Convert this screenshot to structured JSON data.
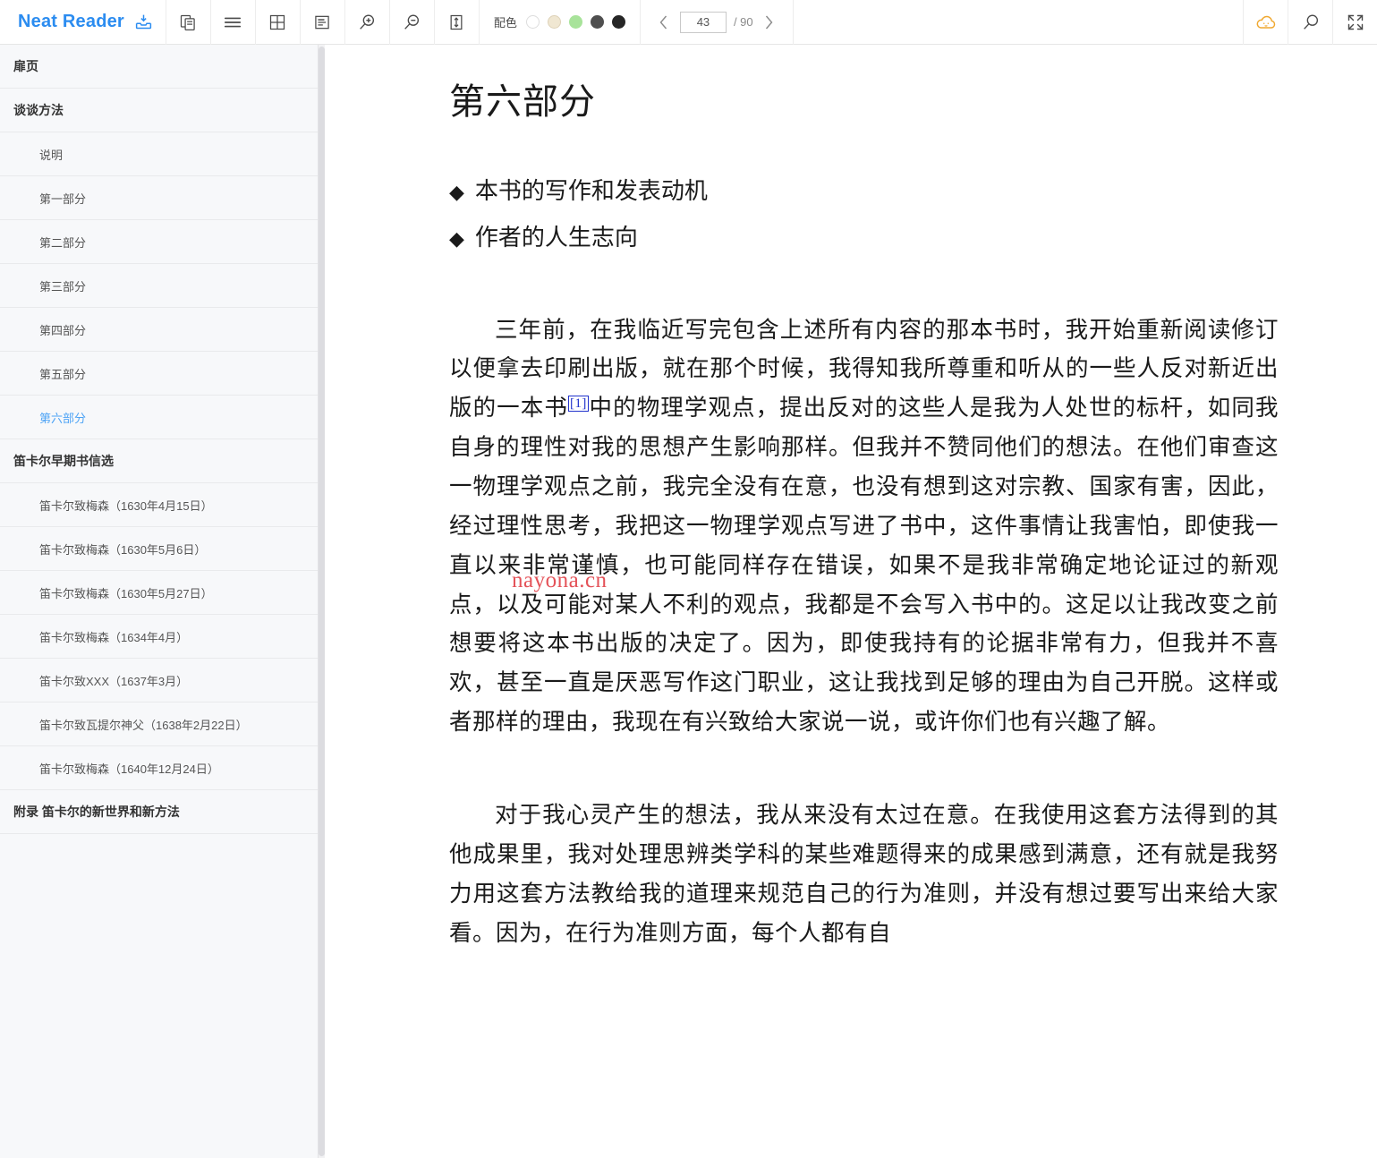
{
  "app": {
    "brand": "Neat Reader",
    "download_icon": "download-tray-icon"
  },
  "toolbar": {
    "buttons": [
      {
        "name": "copy-pages-icon",
        "title": "复制"
      },
      {
        "name": "list-lines-icon",
        "title": "目录"
      },
      {
        "name": "grid-layout-icon",
        "title": "双页"
      },
      {
        "name": "text-layout-icon",
        "title": "排版"
      },
      {
        "name": "zoom-in-icon",
        "title": "放大"
      },
      {
        "name": "zoom-out-icon",
        "title": "缩小"
      },
      {
        "name": "line-height-icon",
        "title": "行距"
      }
    ],
    "scheme_label": "配色",
    "swatches": [
      {
        "name": "scheme-white",
        "color": "#ffffff",
        "border": "#dddddd"
      },
      {
        "name": "scheme-cream",
        "color": "#f0e7d2",
        "border": "#ded2b8"
      },
      {
        "name": "scheme-green",
        "color": "#a8e39a",
        "border": "#a8e39a"
      },
      {
        "name": "scheme-gray",
        "color": "#4f4f4f",
        "border": "#4f4f4f"
      },
      {
        "name": "scheme-black",
        "color": "#262626",
        "border": "#262626"
      }
    ],
    "pager": {
      "prev": "‹",
      "current": "43",
      "separator": "/ 90",
      "total": "90",
      "next": "›"
    },
    "right_buttons": [
      {
        "name": "cloud-sync-icon",
        "title": "云同步",
        "color": "#f0a830"
      },
      {
        "name": "search-icon",
        "title": "搜索"
      },
      {
        "name": "fullscreen-icon",
        "title": "全屏"
      }
    ]
  },
  "sidebar": {
    "items": [
      {
        "label": "扉页",
        "level": 0,
        "active": false
      },
      {
        "label": "谈谈方法",
        "level": 0,
        "active": false
      },
      {
        "label": "说明",
        "level": 1,
        "active": false
      },
      {
        "label": "第一部分",
        "level": 1,
        "active": false
      },
      {
        "label": "第二部分",
        "level": 1,
        "active": false
      },
      {
        "label": "第三部分",
        "level": 1,
        "active": false
      },
      {
        "label": "第四部分",
        "level": 1,
        "active": false
      },
      {
        "label": "第五部分",
        "level": 1,
        "active": false
      },
      {
        "label": "第六部分",
        "level": 1,
        "active": true
      },
      {
        "label": "笛卡尔早期书信选",
        "level": 0,
        "active": false
      },
      {
        "label": "笛卡尔致梅森（1630年4月15日）",
        "level": 1,
        "active": false
      },
      {
        "label": "笛卡尔致梅森（1630年5月6日）",
        "level": 1,
        "active": false
      },
      {
        "label": "笛卡尔致梅森（1630年5月27日）",
        "level": 1,
        "active": false
      },
      {
        "label": "笛卡尔致梅森（1634年4月）",
        "level": 1,
        "active": false
      },
      {
        "label": "笛卡尔致XXX（1637年3月）",
        "level": 1,
        "active": false
      },
      {
        "label": "笛卡尔致瓦提尔神父（1638年2月22日）",
        "level": 1,
        "active": false
      },
      {
        "label": "笛卡尔致梅森（1640年12月24日）",
        "level": 1,
        "active": false
      },
      {
        "label": "附录 笛卡尔的新世界和新方法",
        "level": 0,
        "active": false
      }
    ]
  },
  "page": {
    "title": "第六部分",
    "bullets": [
      {
        "mark": "◆",
        "text": "本书的写作和发表动机"
      },
      {
        "mark": "◆",
        "text": "作者的人生志向"
      }
    ],
    "paragraph1_a": "三年前，在我临近写完包含上述所有内容的那本书时，我开始重新阅读修订以便拿去印刷出版，就在那个时候，我得知我所尊重和听从的一些人反对新近出版的一本书",
    "footnote_ref": "[1]",
    "paragraph1_b": "中的物理学观点，提出反对的这些人是我为人处世的标杆，如同我自身的理性对我的思想产生影响那样。但我并不赞同他们的想法。在他们审查这一物理学观点之前，我完全没有在意，也没有想到这对宗教、国家有害，因此，经过理性思考，我把这一物理学观点写进了书中，这件事情让我害怕，即使我一直以来非常谨慎，也可能同样存在错误，如果不是我非常确定地论证过的新观点，以及可能对某人不利的观点，我都是不会写入书中的。这足以让我改变之前想要将这本书出版的决定了。因为，即使我持有的论据非常有力，但我并不喜欢，甚至一直是厌恶写作这门职业，这让我找到足够的理由为自己开脱。这样或者那样的理由，我现在有兴致给大家说一说，或许你们也有兴趣了解。",
    "paragraph2": "对于我心灵产生的想法，我从来没有太过在意。在我使用这套方法得到的其他成果里，我对处理思辨类学科的某些难题得来的成果感到满意，还有就是我努力用这套方法教给我的道理来规范自己的行为准则，并没有想过要写出来给大家看。因为，在行为准则方面，每个人都有自",
    "watermark": "nayona.cn"
  }
}
